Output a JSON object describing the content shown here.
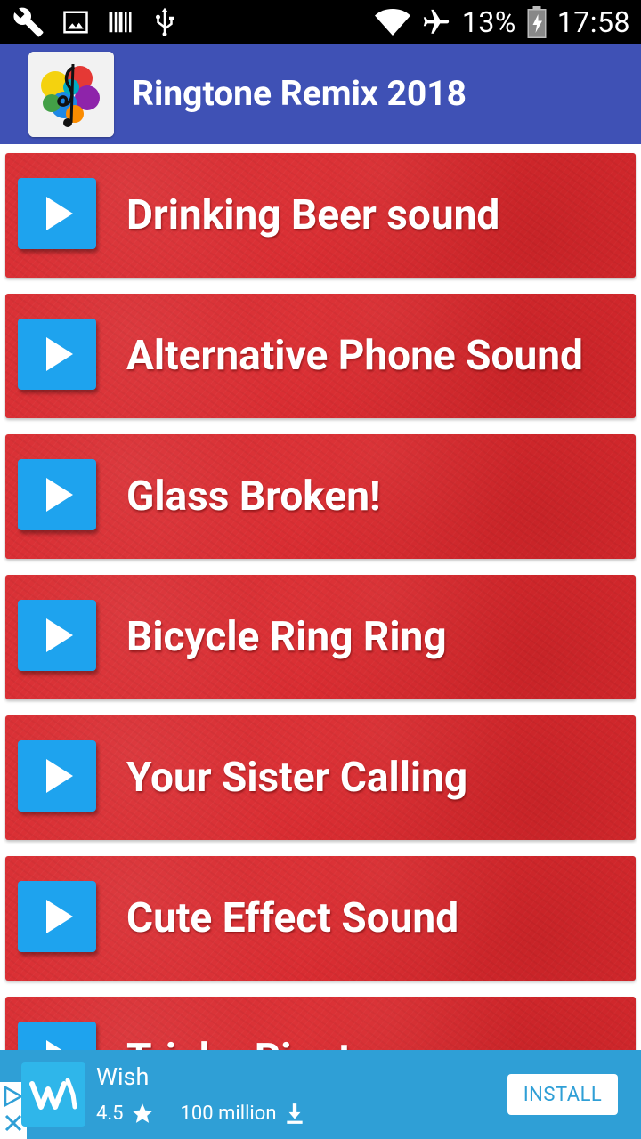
{
  "status_bar": {
    "battery_percent": "13%",
    "time": "17:58",
    "left_icons": [
      "wrench-icon",
      "image-icon",
      "barcode-icon",
      "usb-icon"
    ],
    "right_icons": [
      "wifi-icon",
      "airplane-icon",
      "battery-icon"
    ]
  },
  "app_bar": {
    "title": "Ringtone Remix 2018",
    "icon": "music-note-splash-icon",
    "color": "#3f51b5"
  },
  "list": {
    "items": [
      {
        "label": "Drinking Beer sound"
      },
      {
        "label": "Alternative Phone Sound"
      },
      {
        "label": "Glass Broken!"
      },
      {
        "label": "Bicycle Ring Ring"
      },
      {
        "label": "Your Sister Calling"
      },
      {
        "label": "Cute Effect Sound"
      },
      {
        "label": "Trinko Ringtone"
      }
    ],
    "row_color": "#d92b30",
    "play_button_color": "#1ea3ee"
  },
  "ad": {
    "app_name": "Wish",
    "rating": "4.5",
    "downloads": "100 million",
    "install_label": "INSTALL",
    "background": "#2f9fd6"
  }
}
